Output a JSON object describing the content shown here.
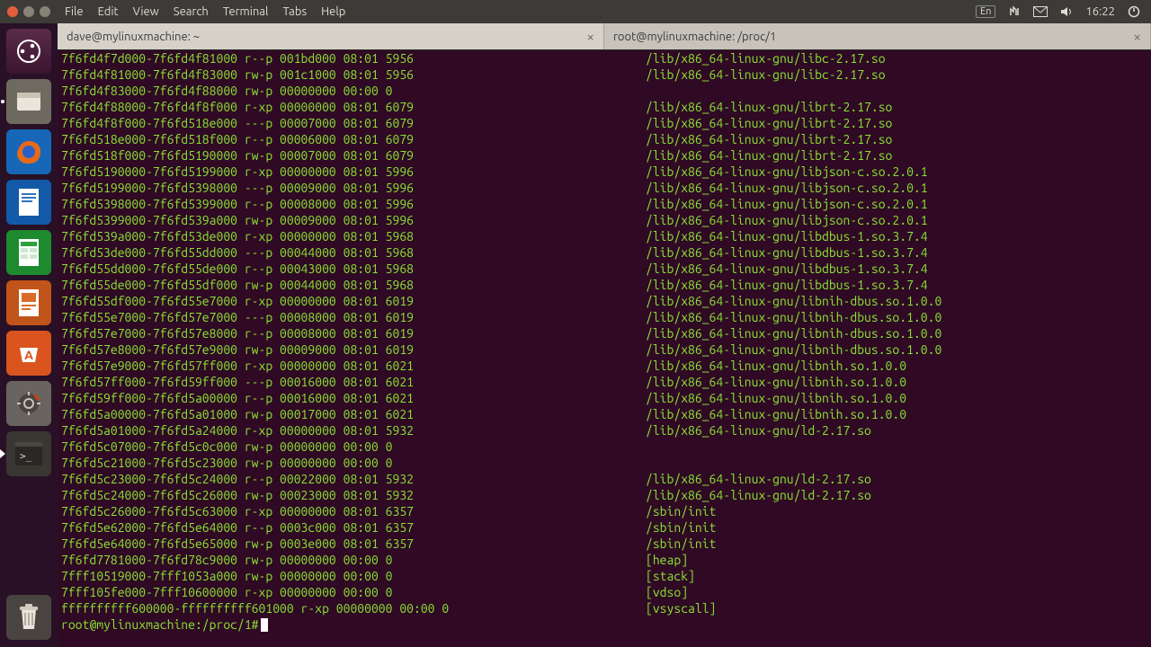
{
  "menubar": {
    "items": [
      "File",
      "Edit",
      "View",
      "Search",
      "Terminal",
      "Tabs",
      "Help"
    ],
    "lang": "En",
    "time": "16:22"
  },
  "tabs": [
    {
      "title": "dave@mylinuxmachine: ~",
      "active": true
    },
    {
      "title": "root@mylinuxmachine: /proc/1",
      "active": false
    }
  ],
  "prompt": "root@mylinuxmachine:/proc/1#",
  "map_lines": [
    {
      "main": "7f6fd4f7d000-7f6fd4f81000 r--p 001bd000 08:01 5956",
      "path": "/lib/x86_64-linux-gnu/libc-2.17.so"
    },
    {
      "main": "7f6fd4f81000-7f6fd4f83000 rw-p 001c1000 08:01 5956",
      "path": "/lib/x86_64-linux-gnu/libc-2.17.so"
    },
    {
      "main": "7f6fd4f83000-7f6fd4f88000 rw-p 00000000 00:00 0",
      "path": ""
    },
    {
      "main": "7f6fd4f88000-7f6fd4f8f000 r-xp 00000000 08:01 6079",
      "path": "/lib/x86_64-linux-gnu/librt-2.17.so"
    },
    {
      "main": "7f6fd4f8f000-7f6fd518e000 ---p 00007000 08:01 6079",
      "path": "/lib/x86_64-linux-gnu/librt-2.17.so"
    },
    {
      "main": "7f6fd518e000-7f6fd518f000 r--p 00006000 08:01 6079",
      "path": "/lib/x86_64-linux-gnu/librt-2.17.so"
    },
    {
      "main": "7f6fd518f000-7f6fd5190000 rw-p 00007000 08:01 6079",
      "path": "/lib/x86_64-linux-gnu/librt-2.17.so"
    },
    {
      "main": "7f6fd5190000-7f6fd5199000 r-xp 00000000 08:01 5996",
      "path": "/lib/x86_64-linux-gnu/libjson-c.so.2.0.1"
    },
    {
      "main": "7f6fd5199000-7f6fd5398000 ---p 00009000 08:01 5996",
      "path": "/lib/x86_64-linux-gnu/libjson-c.so.2.0.1"
    },
    {
      "main": "7f6fd5398000-7f6fd5399000 r--p 00008000 08:01 5996",
      "path": "/lib/x86_64-linux-gnu/libjson-c.so.2.0.1"
    },
    {
      "main": "7f6fd5399000-7f6fd539a000 rw-p 00009000 08:01 5996",
      "path": "/lib/x86_64-linux-gnu/libjson-c.so.2.0.1"
    },
    {
      "main": "7f6fd539a000-7f6fd53de000 r-xp 00000000 08:01 5968",
      "path": "/lib/x86_64-linux-gnu/libdbus-1.so.3.7.4"
    },
    {
      "main": "7f6fd53de000-7f6fd55dd000 ---p 00044000 08:01 5968",
      "path": "/lib/x86_64-linux-gnu/libdbus-1.so.3.7.4"
    },
    {
      "main": "7f6fd55dd000-7f6fd55de000 r--p 00043000 08:01 5968",
      "path": "/lib/x86_64-linux-gnu/libdbus-1.so.3.7.4"
    },
    {
      "main": "7f6fd55de000-7f6fd55df000 rw-p 00044000 08:01 5968",
      "path": "/lib/x86_64-linux-gnu/libdbus-1.so.3.7.4"
    },
    {
      "main": "7f6fd55df000-7f6fd55e7000 r-xp 00000000 08:01 6019",
      "path": "/lib/x86_64-linux-gnu/libnih-dbus.so.1.0.0"
    },
    {
      "main": "7f6fd55e7000-7f6fd57e7000 ---p 00008000 08:01 6019",
      "path": "/lib/x86_64-linux-gnu/libnih-dbus.so.1.0.0"
    },
    {
      "main": "7f6fd57e7000-7f6fd57e8000 r--p 00008000 08:01 6019",
      "path": "/lib/x86_64-linux-gnu/libnih-dbus.so.1.0.0"
    },
    {
      "main": "7f6fd57e8000-7f6fd57e9000 rw-p 00009000 08:01 6019",
      "path": "/lib/x86_64-linux-gnu/libnih-dbus.so.1.0.0"
    },
    {
      "main": "7f6fd57e9000-7f6fd57ff000 r-xp 00000000 08:01 6021",
      "path": "/lib/x86_64-linux-gnu/libnih.so.1.0.0"
    },
    {
      "main": "7f6fd57ff000-7f6fd59ff000 ---p 00016000 08:01 6021",
      "path": "/lib/x86_64-linux-gnu/libnih.so.1.0.0"
    },
    {
      "main": "7f6fd59ff000-7f6fd5a00000 r--p 00016000 08:01 6021",
      "path": "/lib/x86_64-linux-gnu/libnih.so.1.0.0"
    },
    {
      "main": "7f6fd5a00000-7f6fd5a01000 rw-p 00017000 08:01 6021",
      "path": "/lib/x86_64-linux-gnu/libnih.so.1.0.0"
    },
    {
      "main": "7f6fd5a01000-7f6fd5a24000 r-xp 00000000 08:01 5932",
      "path": "/lib/x86_64-linux-gnu/ld-2.17.so"
    },
    {
      "main": "7f6fd5c07000-7f6fd5c0c000 rw-p 00000000 00:00 0",
      "path": ""
    },
    {
      "main": "7f6fd5c21000-7f6fd5c23000 rw-p 00000000 00:00 0",
      "path": ""
    },
    {
      "main": "7f6fd5c23000-7f6fd5c24000 r--p 00022000 08:01 5932",
      "path": "/lib/x86_64-linux-gnu/ld-2.17.so"
    },
    {
      "main": "7f6fd5c24000-7f6fd5c26000 rw-p 00023000 08:01 5932",
      "path": "/lib/x86_64-linux-gnu/ld-2.17.so"
    },
    {
      "main": "7f6fd5c26000-7f6fd5c63000 r-xp 00000000 08:01 6357",
      "path": "/sbin/init"
    },
    {
      "main": "7f6fd5e62000-7f6fd5e64000 r--p 0003c000 08:01 6357",
      "path": "/sbin/init"
    },
    {
      "main": "7f6fd5e64000-7f6fd5e65000 rw-p 0003e000 08:01 6357",
      "path": "/sbin/init"
    },
    {
      "main": "7f6fd7781000-7f6fd78c9000 rw-p 00000000 00:00 0",
      "path": "[heap]"
    },
    {
      "main": "7fff10519000-7fff1053a000 rw-p 00000000 00:00 0",
      "path": "[stack]"
    },
    {
      "main": "7fff105fe000-7fff10600000 r-xp 00000000 00:00 0",
      "path": "[vdso]"
    },
    {
      "main": "ffffffffff600000-ffffffffff601000 r-xp 00000000 00:00 0",
      "path": "[vsyscall]"
    }
  ],
  "launcher_icons": [
    "dash",
    "files",
    "firefox",
    "writer",
    "calc",
    "impress",
    "software-center",
    "settings",
    "terminal"
  ]
}
